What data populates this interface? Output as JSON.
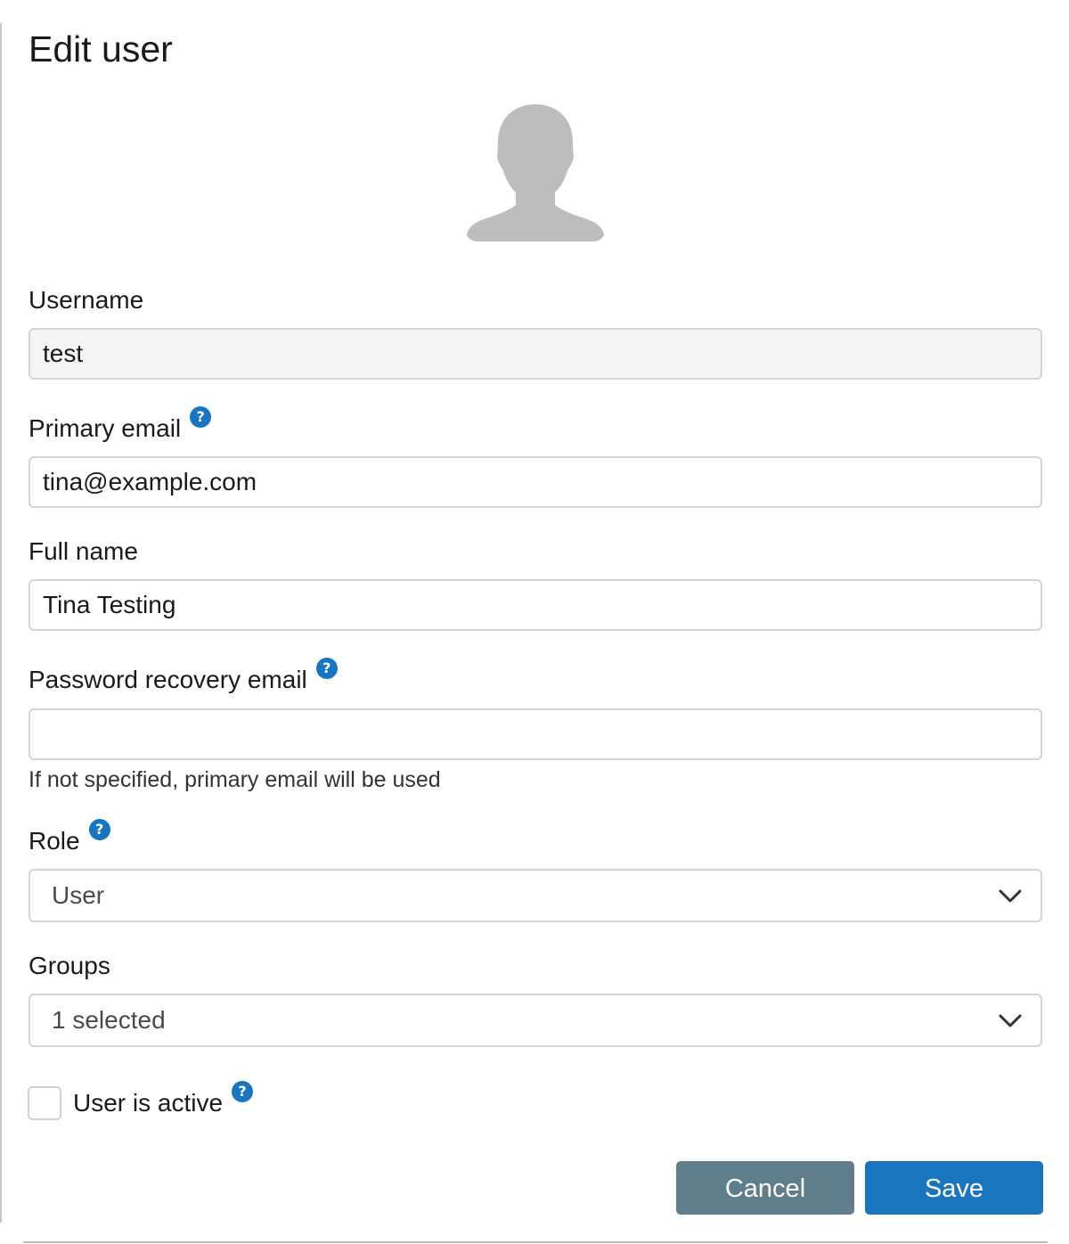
{
  "dialog": {
    "title": "Edit user"
  },
  "avatar": {
    "icon": "user-silhouette-icon"
  },
  "fields": {
    "username": {
      "label": "Username",
      "value": "test"
    },
    "primary_email": {
      "label": "Primary email",
      "value": "tina@example.com",
      "help": "?"
    },
    "full_name": {
      "label": "Full name",
      "value": "Tina Testing"
    },
    "recovery_email": {
      "label": "Password recovery email",
      "value": "",
      "help": "?",
      "hint": "If not specified, primary email will be used"
    },
    "role": {
      "label": "Role",
      "selected": "User",
      "help": "?"
    },
    "groups": {
      "label": "Groups",
      "selected": "1 selected"
    },
    "active": {
      "label": "User is active",
      "checked": false,
      "help": "?"
    }
  },
  "buttons": {
    "cancel": "Cancel",
    "save": "Save"
  },
  "colors": {
    "primary": "#1a75c1",
    "secondary": "#607d8b",
    "border": "#d4d4d4",
    "readonly_bg": "#f4f4f4"
  }
}
